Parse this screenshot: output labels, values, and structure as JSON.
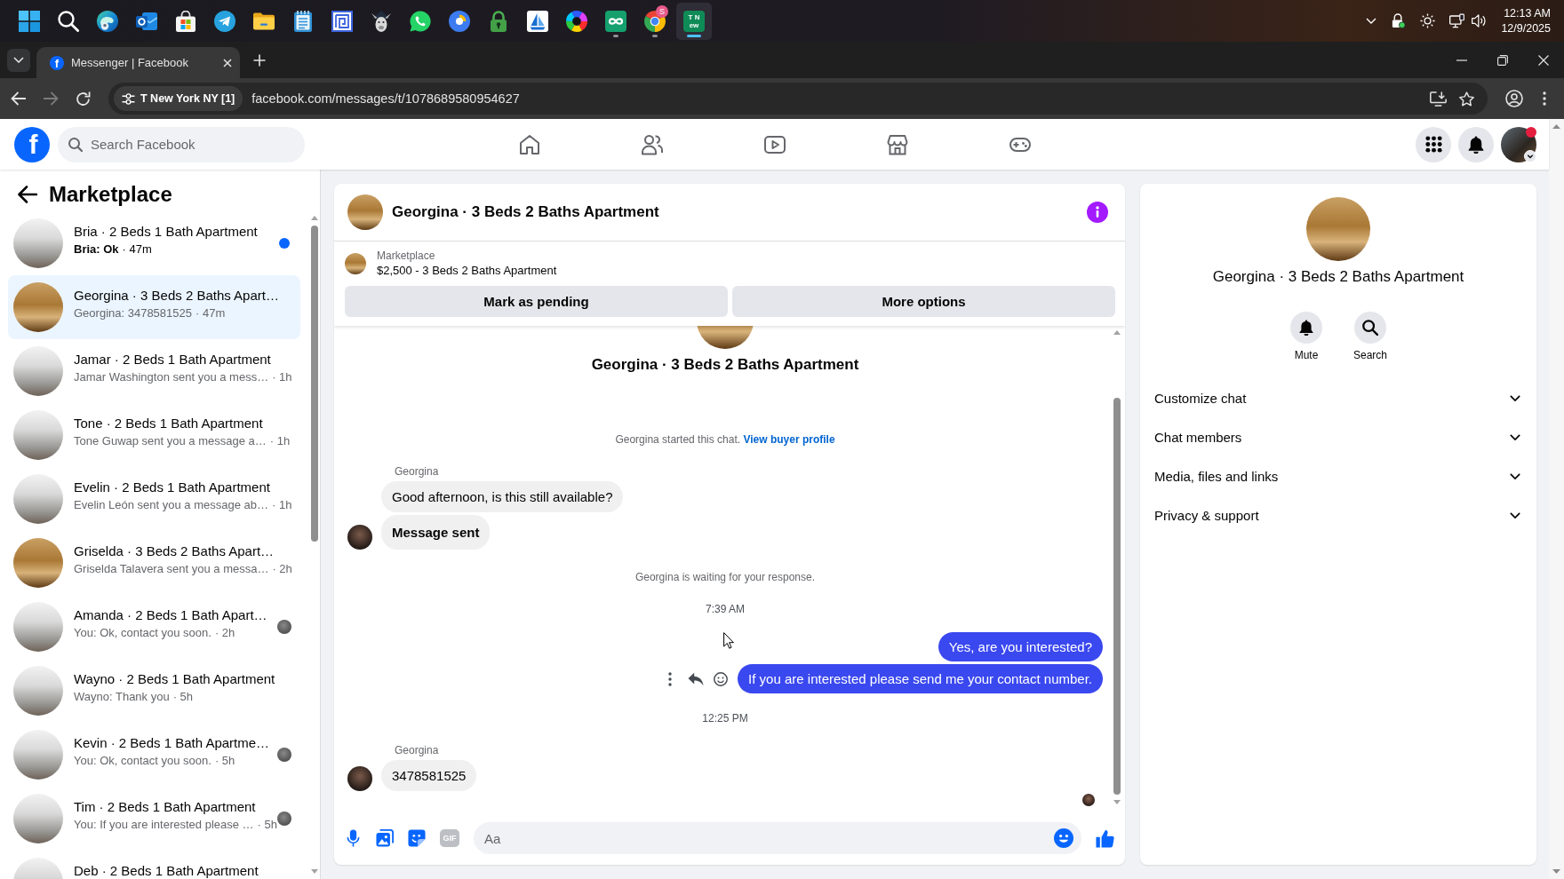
{
  "taskbar": {
    "apps": [
      {
        "kind": "start",
        "running": false,
        "selected": false
      },
      {
        "kind": "search",
        "running": false,
        "selected": false
      },
      {
        "kind": "swirl",
        "running": false,
        "selected": false
      },
      {
        "kind": "mail",
        "running": false,
        "selected": false
      },
      {
        "kind": "store",
        "running": false,
        "selected": false
      },
      {
        "kind": "plane",
        "running": false,
        "selected": false
      },
      {
        "kind": "folder",
        "running": false,
        "selected": false
      },
      {
        "kind": "notepad",
        "running": false,
        "selected": false
      },
      {
        "kind": "maze",
        "running": false,
        "selected": false
      },
      {
        "kind": "mascot",
        "running": false,
        "selected": false
      },
      {
        "kind": "phone",
        "running": false,
        "selected": false
      },
      {
        "kind": "ring",
        "running": false,
        "selected": false
      },
      {
        "kind": "lock",
        "running": false,
        "selected": false
      },
      {
        "kind": "sailboat",
        "running": false,
        "selected": false
      },
      {
        "kind": "wheel",
        "running": false,
        "selected": false
      },
      {
        "kind": "loop",
        "running": true,
        "selected": false
      },
      {
        "kind": "segments",
        "running": true,
        "selected": false,
        "badge": "S"
      },
      {
        "kind": "tile",
        "running": true,
        "selected": true,
        "lines": [
          "T N",
          "ew"
        ]
      }
    ],
    "time": "12:13 AM",
    "date": "12/9/2025"
  },
  "browser": {
    "tabs": [
      {
        "favicon": "f",
        "title": "Messenger | Facebook",
        "selected": true
      }
    ],
    "site_chip": "T New York NY [1]",
    "url": "facebook.com/messages/t/1078689580954627"
  },
  "facebook": {
    "logo": "f",
    "search": {
      "placeholder": "Search Facebook"
    },
    "account_alert": true
  },
  "sidebar": {
    "title": "Marketplace",
    "conversations": [
      {
        "kind": "kitchen",
        "title": "Bria · 2 Beds 1 Bath Apartment",
        "preview": "Bria: Ok",
        "time": "· 47m",
        "unread": true,
        "selected": false,
        "seen": false
      },
      {
        "kind": "room",
        "title": "Georgina · 3 Beds 2 Baths Apart…",
        "preview": "Georgina: 3478581525",
        "time": "· 47m",
        "unread": false,
        "selected": true,
        "seen": false
      },
      {
        "kind": "kitchen",
        "title": "Jamar · 2 Beds 1 Bath Apartment",
        "preview": "Jamar Washington sent you a mess…",
        "time": "· 1h",
        "unread": false,
        "selected": false,
        "seen": false
      },
      {
        "kind": "kitchen",
        "title": "Tone · 2 Beds 1 Bath Apartment",
        "preview": "Tone Guwap sent you a message a…",
        "time": "· 1h",
        "unread": false,
        "selected": false,
        "seen": false
      },
      {
        "kind": "kitchen",
        "title": "Evelin · 2 Beds 1 Bath Apartment",
        "preview": "Evelin León sent you a message ab…",
        "time": "· 1h",
        "unread": false,
        "selected": false,
        "seen": false
      },
      {
        "kind": "room",
        "title": "Griselda · 3 Beds 2 Baths Apart…",
        "preview": "Griselda Talavera sent you a messa…",
        "time": "· 2h",
        "unread": false,
        "selected": false,
        "seen": false
      },
      {
        "kind": "kitchen",
        "title": "Amanda · 2 Beds 1 Bath Apart…",
        "preview": "You: Ok, contact you soon.",
        "time": "· 2h",
        "unread": false,
        "selected": false,
        "seen": true
      },
      {
        "kind": "kitchen",
        "title": "Wayno · 2 Beds 1 Bath Apartment",
        "preview": "Wayno: Thank you",
        "time": "· 5h",
        "unread": false,
        "selected": false,
        "seen": false
      },
      {
        "kind": "kitchen",
        "title": "Kevin · 2 Beds 1 Bath Apartme…",
        "preview": "You: Ok, contact you soon.",
        "time": "· 5h",
        "unread": false,
        "selected": false,
        "seen": true
      },
      {
        "kind": "kitchen",
        "title": "Tim · 2 Beds 1 Bath Apartment",
        "preview": "You: If you are interested please …",
        "time": "· 5h",
        "unread": false,
        "selected": false,
        "seen": true
      },
      {
        "kind": "kitchen",
        "title": "Deb · 2 Beds 1 Bath Apartment",
        "unread": false,
        "selected": false,
        "seen": false
      }
    ]
  },
  "chat": {
    "title": "Georgina · 3 Beds 2 Baths Apartment",
    "listing": {
      "source": "Marketplace",
      "summary": "$2,500 - 3 Beds 2 Baths Apartment",
      "actions": [
        "Mark as pending",
        "More options"
      ]
    },
    "intro": {
      "title": "Georgina · 3 Beds 2 Baths Apartment",
      "note": "Georgina started this chat.",
      "link": "View buyer profile"
    },
    "messages": [
      {
        "kind": "sender",
        "text": "Georgina"
      },
      {
        "kind": "incoming",
        "text": "Good afternoon, is this still available?",
        "avatar": false,
        "strong": false
      },
      {
        "kind": "incoming",
        "text": "Message sent",
        "avatar": true,
        "strong": true
      },
      {
        "kind": "notice",
        "text": "Georgina is waiting for your response."
      },
      {
        "kind": "time",
        "text": "7:39 AM"
      },
      {
        "kind": "outgoing",
        "text": "Yes, are you interested?",
        "hovered": false
      },
      {
        "kind": "outgoing",
        "text": "If you are interested please send me your contact number.",
        "hovered": true
      },
      {
        "kind": "time",
        "text": "12:25 PM"
      },
      {
        "kind": "sender",
        "text": "Georgina"
      },
      {
        "kind": "incoming",
        "text": "3478581525",
        "avatar": true,
        "strong": false
      },
      {
        "kind": "receipt"
      }
    ],
    "composer": {
      "gif_label": "GIF",
      "placeholder": "Aa"
    }
  },
  "details": {
    "title": "Georgina · 3 Beds 2 Baths Apartment",
    "actions": [
      {
        "kind": "mute",
        "label": "Mute"
      },
      {
        "kind": "search",
        "label": "Search"
      }
    ],
    "sections": [
      {
        "label": "Customize chat",
        "expanded": false
      },
      {
        "label": "Chat members",
        "expanded": false
      },
      {
        "label": "Media, files and links",
        "expanded": false
      },
      {
        "label": "Privacy & support",
        "expanded": false
      }
    ]
  }
}
